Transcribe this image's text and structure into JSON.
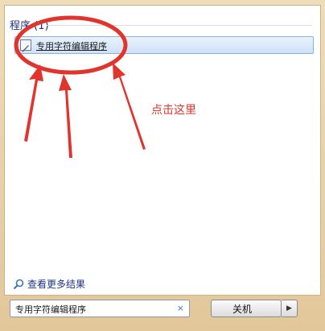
{
  "programs_section": {
    "header": "程序 (1)",
    "results": [
      {
        "label": "专用字符编辑程序",
        "icon": "edit-app-icon"
      }
    ]
  },
  "annotation": {
    "text": "点击这里",
    "color": "#e0342c"
  },
  "footer": {
    "see_more": "查看更多结果",
    "search_value": "专用字符编辑程序",
    "clear_symbol": "×",
    "shutdown_label": "关机",
    "arrow_symbol": "▶"
  },
  "colors": {
    "accent": "#1e3287",
    "highlight": "#cfe1f7",
    "annotation": "#e0342c"
  }
}
